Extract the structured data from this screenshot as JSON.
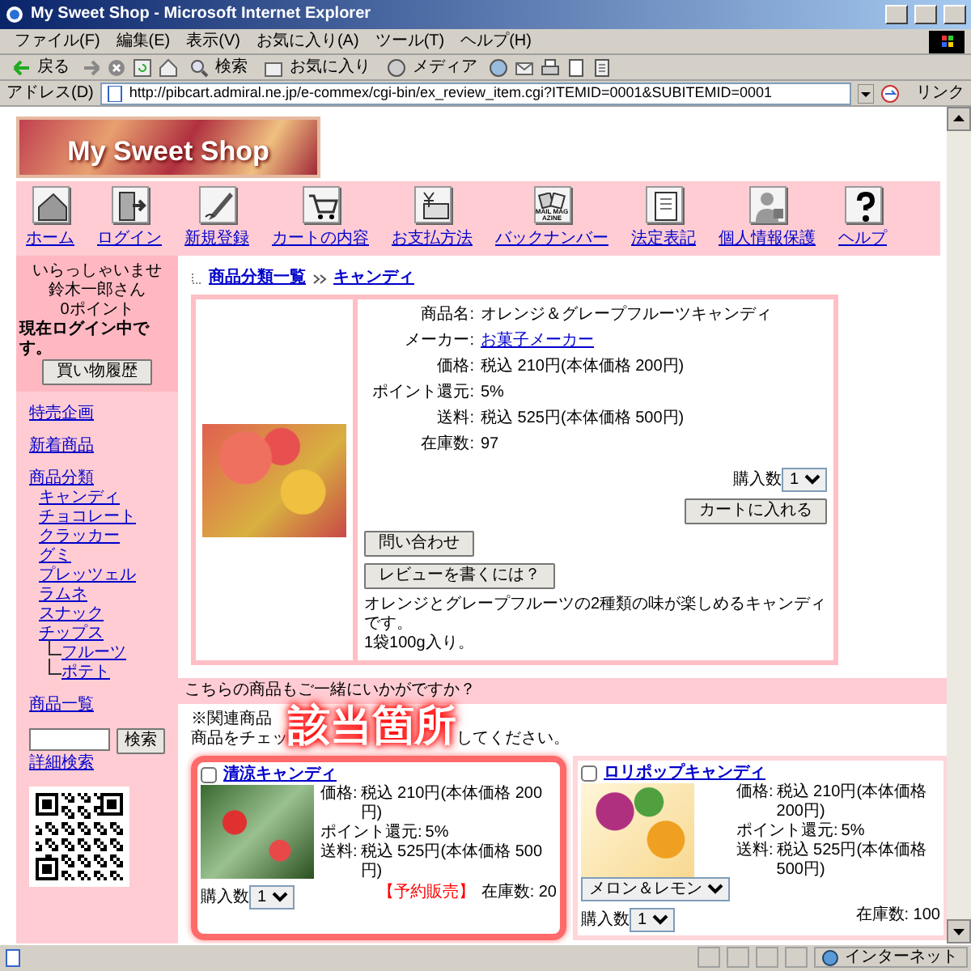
{
  "window": {
    "title": "My Sweet Shop - Microsoft Internet Explorer"
  },
  "menu": [
    "ファイル(F)",
    "編集(E)",
    "表示(V)",
    "お気に入り(A)",
    "ツール(T)",
    "ヘルプ(H)"
  ],
  "toolbar": [
    {
      "kind": "back",
      "label": "戻る"
    },
    {
      "kind": "forward"
    },
    {
      "kind": "stop"
    },
    {
      "kind": "refresh"
    },
    {
      "kind": "home"
    },
    {
      "kind": "search",
      "label": "検索"
    },
    {
      "kind": "favorites",
      "label": "お気に入り"
    },
    {
      "kind": "media",
      "label": "メディア"
    },
    {
      "kind": "history"
    },
    {
      "kind": "mail"
    },
    {
      "kind": "print"
    },
    {
      "kind": "edit"
    },
    {
      "kind": "discuss"
    }
  ],
  "address": {
    "label": "アドレス(D)",
    "url": "http://pibcart.admiral.ne.jp/e-commex/cgi-bin/ex_review_item.cgi?ITEMID=0001&SUBITEMID=0001",
    "links": "リンク"
  },
  "site": {
    "logo": "My Sweet Shop"
  },
  "nav": [
    {
      "kind": "home",
      "label": "ホーム"
    },
    {
      "kind": "login",
      "label": "ログイン"
    },
    {
      "kind": "signup",
      "label": "新規登録"
    },
    {
      "kind": "cart",
      "label": "カートの内容"
    },
    {
      "kind": "payment",
      "label": "お支払方法"
    },
    {
      "kind": "magazine",
      "label": "バックナンバー",
      "icon_text": "MAIL MAGAZINE"
    },
    {
      "kind": "legal",
      "label": "法定表記"
    },
    {
      "kind": "privacy",
      "label": "個人情報保護"
    },
    {
      "kind": "help",
      "label": "ヘルプ"
    }
  ],
  "sidebar": {
    "welcome": [
      "いらっしゃいませ",
      "鈴木一郎さん",
      "0ポイント"
    ],
    "status": "現在ログイン中です。",
    "history_button": "買い物履歴",
    "links": [
      "特売企画",
      "新着商品"
    ],
    "categories": {
      "label": "商品分類",
      "children": [
        {
          "label": "キャンディ"
        },
        {
          "label": "チョコレート"
        },
        {
          "label": "クラッカー"
        },
        {
          "label": "グミ"
        },
        {
          "label": "プレッツェル"
        },
        {
          "label": "ラムネ"
        },
        {
          "label": "スナック"
        },
        {
          "label": "チップス",
          "children": [
            {
              "label": "フルーツ"
            },
            {
              "label": "ポテト"
            }
          ]
        }
      ]
    },
    "all_items": "商品一覧",
    "search_button": "検索",
    "advanced_search": "詳細検索"
  },
  "breadcrumb": [
    "商品分類一覧",
    "キャンディ"
  ],
  "product": {
    "fields": [
      {
        "label": "商品名:",
        "value": "オレンジ＆グレープフルーツキャンディ"
      },
      {
        "label": "メーカー:",
        "value": "お菓子メーカー",
        "kind": "link"
      },
      {
        "label": "価格:",
        "value": "税込 210円(本体価格 200円)"
      },
      {
        "label": "ポイント還元:",
        "value": "5%"
      },
      {
        "label": "送料:",
        "value": "税込 525円(本体価格 500円)"
      },
      {
        "label": "在庫数:",
        "value": "97"
      }
    ],
    "qty_label": "購入数",
    "qty": "1",
    "cart_button": "カートに入れる",
    "inquiry_button": "問い合わせ",
    "review_button": "レビューを書くには？",
    "description": [
      "オレンジとグレープフルーツの2種類の味が楽しめるキャンディです。",
      "1袋100g入り。"
    ]
  },
  "related": {
    "heading": "こちらの商品もご一緒にいかがですか？",
    "note_parts": [
      "※関連商品",
      "商品をチェッ",
      "してください。"
    ],
    "callout": "該当箇所",
    "items": [
      {
        "name": "清涼キャンディ",
        "checked": false,
        "highlighted": true,
        "fields": [
          {
            "label": "価格:",
            "value": "税込 210円(本体価格 200円)"
          },
          {
            "label": "ポイント還元:",
            "value": "5%"
          },
          {
            "label": "送料:",
            "value": "税込 525円(本体価格 500円)"
          }
        ],
        "qty_label": "購入数",
        "qty": "1",
        "tag": "【予約販売】",
        "stock": "在庫数: 20"
      },
      {
        "name": "ロリポップキャンディ",
        "checked": false,
        "highlighted": false,
        "fields": [
          {
            "label": "価格:",
            "value": "税込 210円(本体価格 200円)"
          },
          {
            "label": "ポイント還元:",
            "value": "5%"
          },
          {
            "label": "送料:",
            "value": "税込 525円(本体価格 500円)"
          }
        ],
        "option": "メロン＆レモン",
        "qty_label": "購入数",
        "qty": "1",
        "stock": "在庫数: 100"
      }
    ]
  },
  "status_bar": {
    "zone": "インターネット"
  }
}
